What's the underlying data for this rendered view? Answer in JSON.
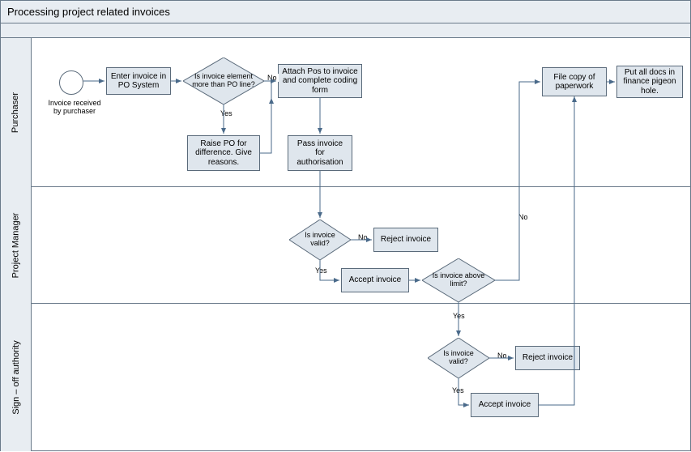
{
  "title": "Processing project related invoices",
  "lanes": {
    "purchaser": "Purchaser",
    "projectManager": "Project Manager",
    "signoff": "Sign – off authority"
  },
  "nodes": {
    "startLabel": "Invoice received by purchaser",
    "enterInvoice": "Enter invoice in PO System",
    "isElementMore": "Is invoice element more than PO line?",
    "raisePO": "Raise PO for difference. Give reasons.",
    "attachPos": "Attach Pos to invoice and complete coding form",
    "passInvoice": "Pass invoice for authorisation",
    "fileCopy": "File copy of paperwork",
    "putAllDocs": "Put all docs in finance pigeon hole.",
    "pmIsValid": "Is invoice valid?",
    "pmReject": "Reject invoice",
    "pmAccept": "Accept invoice",
    "pmAboveLimit": "Is invoice above limit?",
    "soIsValid": "Is invoice valid?",
    "soReject": "Reject invoice",
    "soAccept": "Accept invoice"
  },
  "edgeLabels": {
    "yes": "Yes",
    "no": "No"
  }
}
